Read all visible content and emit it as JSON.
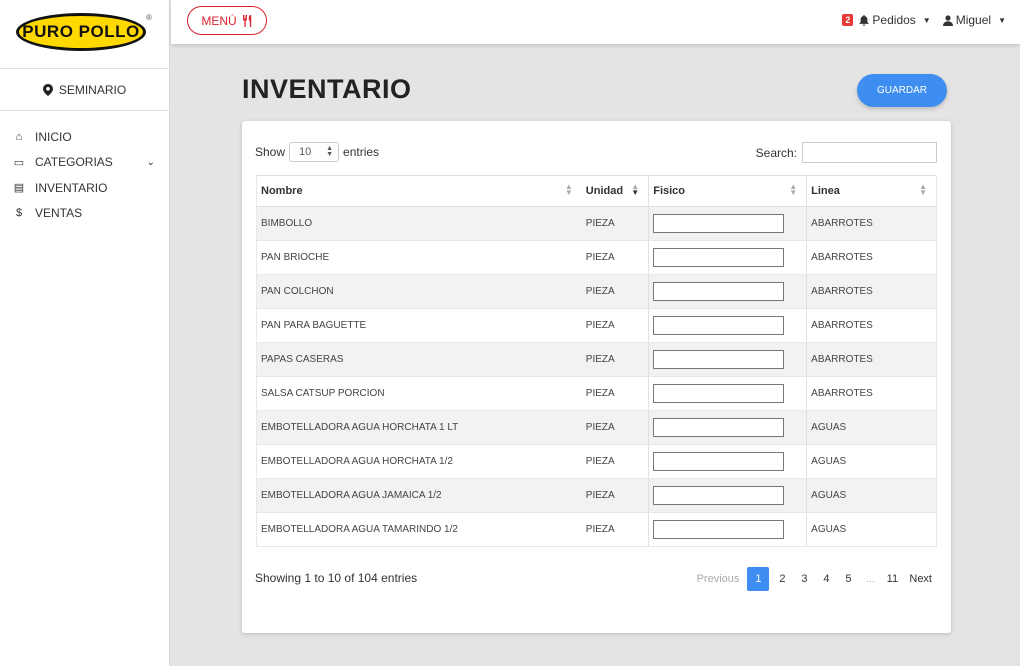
{
  "brand": {
    "logo_text": "PURO POLLO",
    "reg_mark": "®"
  },
  "branch": "SEMINARIO",
  "sidebar": {
    "items": [
      {
        "label": "INICIO",
        "icon": "home-icon",
        "glyph": "⌂"
      },
      {
        "label": "CATEGORIAS",
        "icon": "folder-icon",
        "glyph": "▭",
        "has_chevron": true
      },
      {
        "label": "INVENTARIO",
        "icon": "list-icon",
        "glyph": "▤"
      },
      {
        "label": "VENTAS",
        "icon": "dollar-icon",
        "glyph": "$"
      }
    ]
  },
  "topbar": {
    "menu_label": "MENÚ",
    "notif_count": "2",
    "orders_label": "Pedidos",
    "user_label": "Miguel"
  },
  "page": {
    "title": "INVENTARIO",
    "save_label": "GUARDAR"
  },
  "table": {
    "length_prefix": "Show",
    "length_value": "10",
    "length_suffix": "entries",
    "search_label": "Search:",
    "columns": [
      "Nombre",
      "Unidad",
      "Fisico",
      "Linea"
    ],
    "rows": [
      {
        "nombre": "BIMBOLLO",
        "unidad": "PIEZA",
        "fisico": "",
        "linea": "ABARROTES"
      },
      {
        "nombre": "PAN BRIOCHE",
        "unidad": "PIEZA",
        "fisico": "",
        "linea": "ABARROTES"
      },
      {
        "nombre": "PAN COLCHON",
        "unidad": "PIEZA",
        "fisico": "",
        "linea": "ABARROTES"
      },
      {
        "nombre": "PAN PARA BAGUETTE",
        "unidad": "PIEZA",
        "fisico": "",
        "linea": "ABARROTES"
      },
      {
        "nombre": "PAPAS CASERAS",
        "unidad": "PIEZA",
        "fisico": "",
        "linea": "ABARROTES"
      },
      {
        "nombre": "SALSA CATSUP PORCION",
        "unidad": "PIEZA",
        "fisico": "",
        "linea": "ABARROTES"
      },
      {
        "nombre": "EMBOTELLADORA AGUA HORCHATA 1 LT",
        "unidad": "PIEZA",
        "fisico": "",
        "linea": "AGUAS"
      },
      {
        "nombre": "EMBOTELLADORA AGUA HORCHATA 1/2",
        "unidad": "PIEZA",
        "fisico": "",
        "linea": "AGUAS"
      },
      {
        "nombre": "EMBOTELLADORA AGUA JAMAICA 1/2",
        "unidad": "PIEZA",
        "fisico": "",
        "linea": "AGUAS"
      },
      {
        "nombre": "EMBOTELLADORA AGUA TAMARINDO 1/2",
        "unidad": "PIEZA",
        "fisico": "",
        "linea": "AGUAS"
      }
    ],
    "info": "Showing 1 to 10 of 104 entries",
    "pagination": {
      "previous": "Previous",
      "pages": [
        "1",
        "2",
        "3",
        "4",
        "5",
        "…",
        "11"
      ],
      "current": "1",
      "next": "Next"
    }
  },
  "colors": {
    "accent": "#3d8ef0",
    "brand_red": "#d9232e",
    "brand_yellow": "#ffd800"
  }
}
